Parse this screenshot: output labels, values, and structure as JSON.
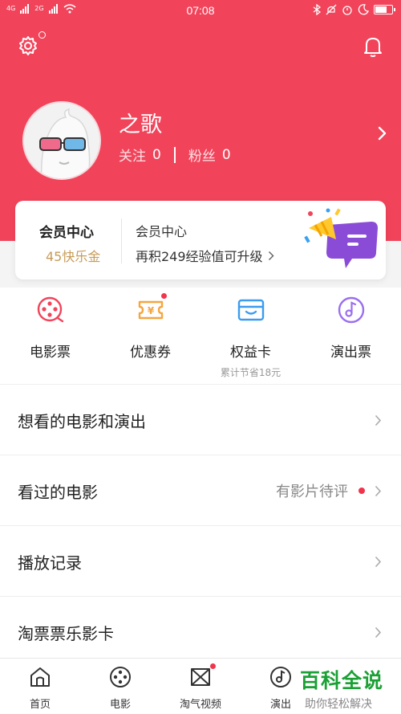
{
  "status_bar": {
    "time": "07:08",
    "signal_left": "4G",
    "signal_right": "2G"
  },
  "profile": {
    "username": "之歌",
    "follow_label": "关注",
    "follow_count": "0",
    "fans_label": "粉丝",
    "fans_count": "0"
  },
  "member_card": {
    "title": "会员中心",
    "coins": "45快乐金",
    "subtitle": "会员中心",
    "desc": "再积249经验值可升级"
  },
  "shortcuts": [
    {
      "label": "电影票",
      "sub": ""
    },
    {
      "label": "优惠券",
      "sub": ""
    },
    {
      "label": "权益卡",
      "sub": "累计节省18元"
    },
    {
      "label": "演出票",
      "sub": ""
    }
  ],
  "list_rows": [
    {
      "label": "想看的电影和演出",
      "value": ""
    },
    {
      "label": "看过的电影",
      "value": "有影片待评"
    },
    {
      "label": "播放记录",
      "value": ""
    },
    {
      "label": "淘票票乐影卡",
      "value": ""
    }
  ],
  "tabs": [
    {
      "label": "首页",
      "icon": "home-icon"
    },
    {
      "label": "电影",
      "icon": "film-reel-icon"
    },
    {
      "label": "淘气视频",
      "icon": "video-icon"
    },
    {
      "label": "演出",
      "icon": "music-note-icon"
    }
  ],
  "watermark": {
    "main": "百科全说",
    "sub": "助你轻松解决"
  },
  "colors": {
    "brand": "#f1445b",
    "gold": "#c79b58",
    "badge": "#f1344c"
  }
}
